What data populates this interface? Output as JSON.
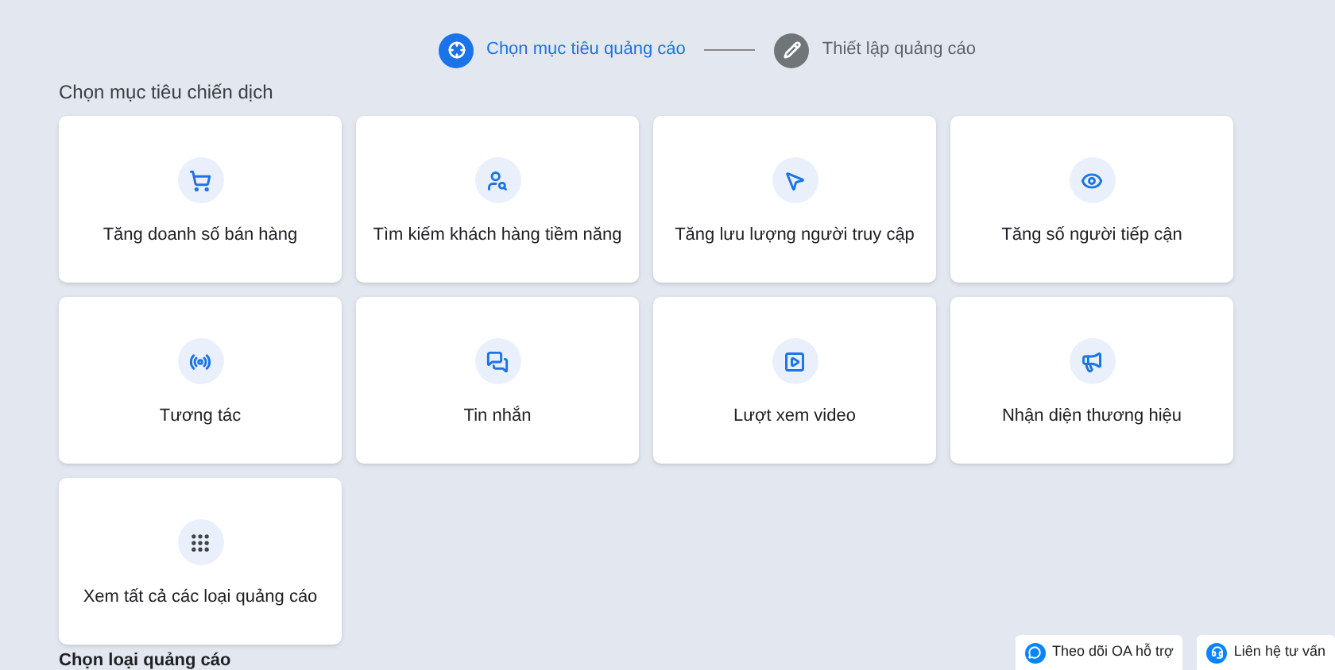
{
  "steps": [
    {
      "label": "Chọn mục tiêu quảng cáo",
      "selected": true
    },
    {
      "label": "Thiết lập quảng cáo",
      "selected": false
    }
  ],
  "section_title": "Chọn mục tiêu chiến dịch",
  "goals": [
    {
      "label": "Tăng doanh số bán hàng"
    },
    {
      "label": "Tìm kiếm khách hàng tiềm năng"
    },
    {
      "label": "Tăng lưu lượng người truy cập"
    },
    {
      "label": "Tăng số người tiếp cận"
    },
    {
      "label": "Tương tác"
    },
    {
      "label": "Tin nhắn"
    },
    {
      "label": "Lượt xem video"
    },
    {
      "label": "Nhận diện thương hiệu"
    },
    {
      "label": "Xem tất cả các loại quảng cáo"
    }
  ],
  "next_section_title": "Chọn loại quảng cáo",
  "support_buttons": [
    {
      "label": "Theo dõi OA hỗ trợ"
    },
    {
      "label": "Liên hệ tư vấn"
    }
  ]
}
